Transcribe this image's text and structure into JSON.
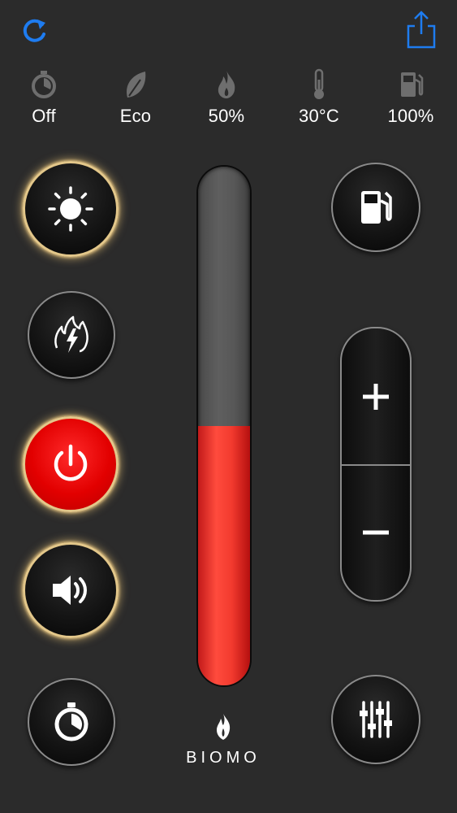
{
  "toolbar": {
    "refresh_icon": "refresh-icon",
    "share_icon": "share-icon",
    "accent": "#1e7cf0"
  },
  "status": [
    {
      "id": "timer",
      "icon": "stopwatch-icon",
      "label": "Off"
    },
    {
      "id": "eco",
      "icon": "leaf-icon",
      "label": "Eco"
    },
    {
      "id": "flame",
      "icon": "flame-icon",
      "label": "50%"
    },
    {
      "id": "temperature",
      "icon": "thermometer-icon",
      "label": "30°C"
    },
    {
      "id": "fuel",
      "icon": "fuel-pump-icon",
      "label": "100%"
    }
  ],
  "controls": {
    "light": {
      "icon": "sun-icon",
      "active": true
    },
    "boost": {
      "icon": "flame-bolt-icon",
      "active": false
    },
    "power": {
      "icon": "power-icon",
      "active": true,
      "color": "#e60000"
    },
    "sound": {
      "icon": "speaker-icon",
      "active": true
    },
    "timer": {
      "icon": "stopwatch-icon",
      "active": false
    },
    "fuel": {
      "icon": "fuel-pump-icon",
      "active": false
    },
    "settings": {
      "icon": "sliders-icon",
      "active": false
    }
  },
  "flame_level": {
    "fraction": 0.5,
    "fill_color": "#ef3a2e"
  },
  "stepper": {
    "plus_icon": "plus-icon",
    "minus_icon": "minus-icon"
  },
  "brand": {
    "name": "BIOMO"
  },
  "colors": {
    "background": "#2b2b2b",
    "glow": "#e3c78a"
  }
}
